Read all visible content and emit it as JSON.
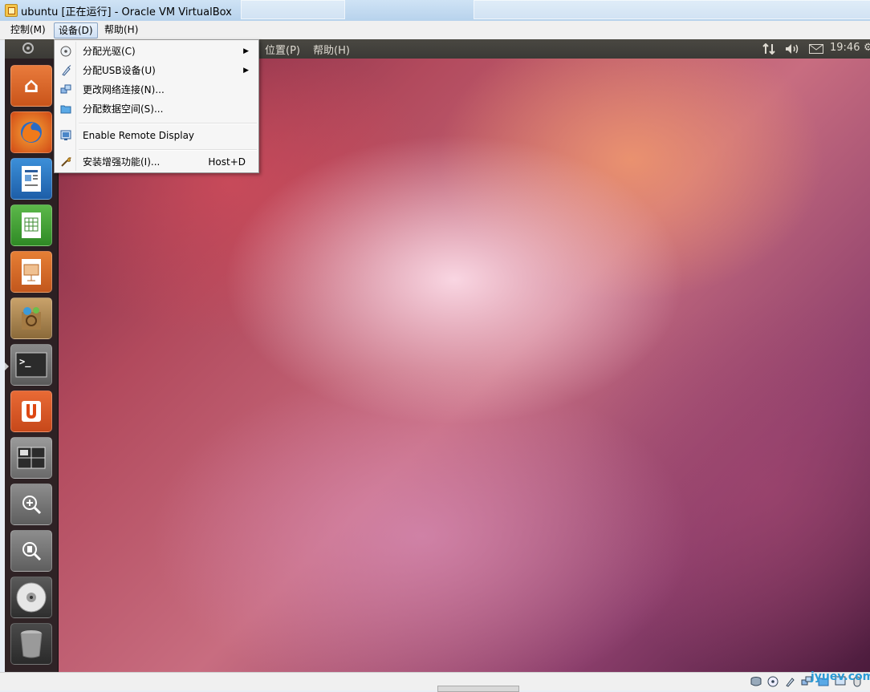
{
  "window": {
    "title": "ubuntu [正在运行] - Oracle VM VirtualBox",
    "icon": "virtualbox-icon"
  },
  "menubar": [
    {
      "label": "控制(M)"
    },
    {
      "label": "设备(D)",
      "active": true
    },
    {
      "label": "帮助(H)"
    }
  ],
  "devices_menu": {
    "items": [
      {
        "label": "分配光驱(C)",
        "icon": "optical-disk-icon",
        "submenu": true
      },
      {
        "label": "分配USB设备(U)",
        "icon": "usb-icon",
        "submenu": true
      },
      {
        "label": "更改网络连接(N)...",
        "icon": "network-icon"
      },
      {
        "label": "分配数据空间(S)...",
        "icon": "shared-folder-icon"
      },
      {
        "label": "Enable Remote Display",
        "icon": "remote-display-icon"
      },
      {
        "label": "安装增强功能(I)...",
        "icon": "install-additions-icon",
        "shortcut": "Host+D"
      }
    ]
  },
  "guest": {
    "panel": {
      "places_label": "位置(P)",
      "help_label": "帮助(H)",
      "clock": "19:46"
    },
    "launcher": [
      {
        "icon": "home-folder-icon"
      },
      {
        "icon": "firefox-icon"
      },
      {
        "icon": "writer-icon"
      },
      {
        "icon": "calc-icon"
      },
      {
        "icon": "impress-icon"
      },
      {
        "icon": "software-center-icon"
      },
      {
        "icon": "terminal-icon"
      },
      {
        "icon": "ubuntu-one-icon"
      },
      {
        "icon": "workspace-switcher-icon"
      },
      {
        "icon": "zoom-in-icon"
      },
      {
        "icon": "zoom-search-icon"
      },
      {
        "icon": "cd-icon"
      },
      {
        "icon": "trash-icon"
      }
    ]
  },
  "watermark": "jyuev.com",
  "colors": {
    "accent": "#dd4814",
    "panel": "#3c3b37",
    "menu_bg": "#f6f6f6"
  }
}
